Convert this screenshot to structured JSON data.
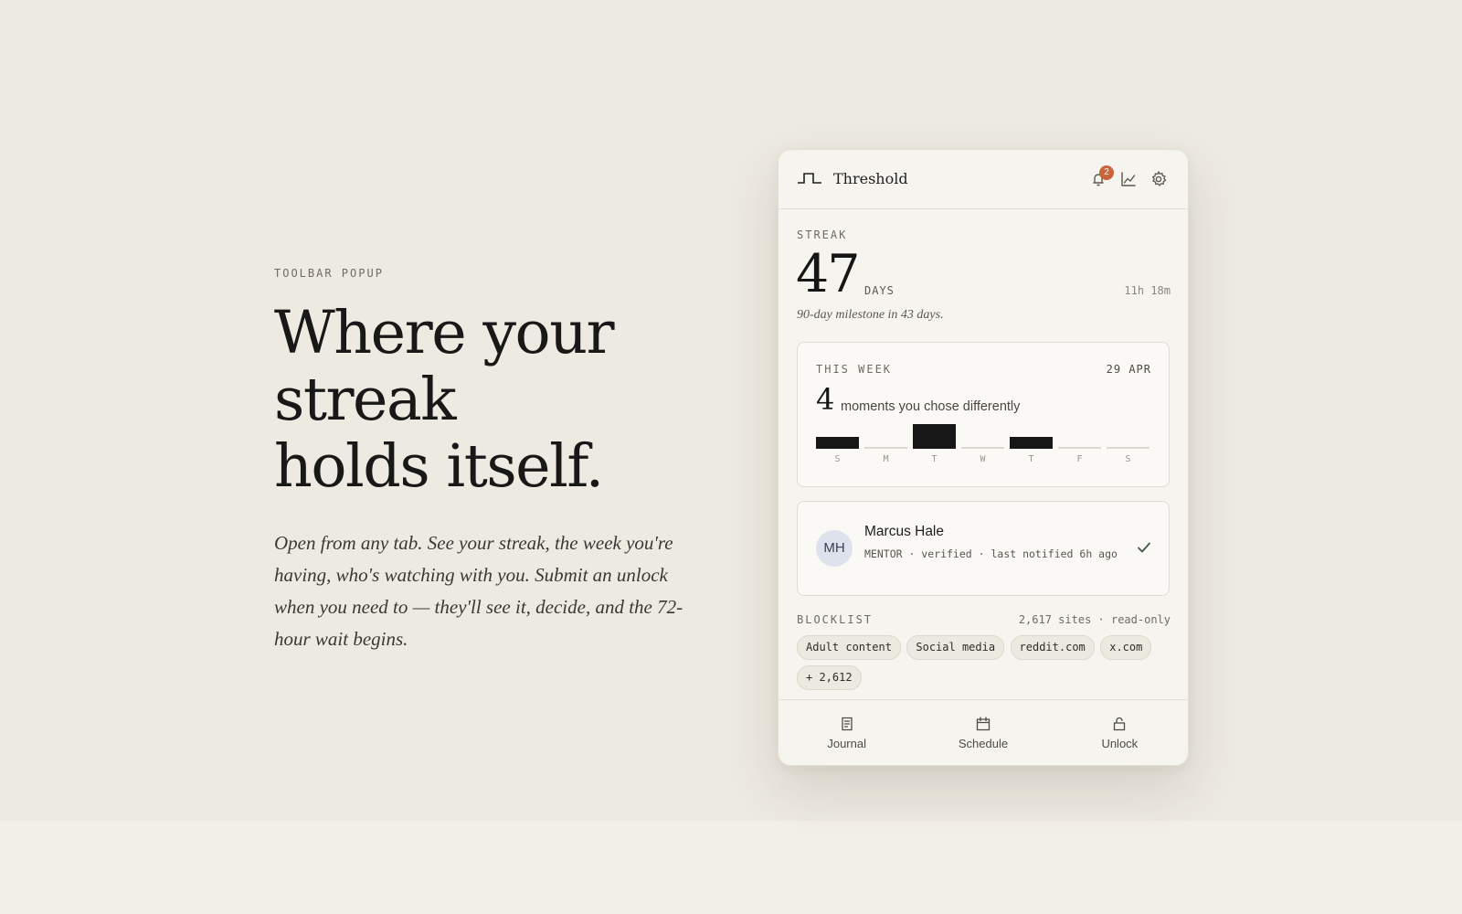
{
  "intro": {
    "eyebrow": "TOOLBAR POPUP",
    "headline_lines": [
      "Where your",
      "streak",
      "holds itself."
    ],
    "lede": "Open from any tab. See your streak, the week you're having, who's watching with you. Submit an unlock when you need to — they'll see it, decide, and the 72-hour wait begins."
  },
  "popup": {
    "brand": "Threshold",
    "header_icons": [
      "bell-icon",
      "chart-icon",
      "gear-icon"
    ],
    "notification_count": "2",
    "streak": {
      "label": "STREAK",
      "days": "47",
      "unit": "DAYS",
      "timer": "11h 18m",
      "milestone": "90-day milestone in 43 days."
    },
    "week": {
      "label": "THIS WEEK",
      "date": "29 APR",
      "count": "4",
      "count_text": "moments you chose differently",
      "days": [
        "S",
        "M",
        "T",
        "W",
        "T",
        "F",
        "S"
      ],
      "moments": [
        1,
        0,
        2,
        0,
        1,
        0,
        0
      ]
    },
    "mentor": {
      "initials": "MH",
      "name": "Marcus Hale",
      "meta": "MENTOR · verified · last notified 6h ago",
      "status_icon": "check-icon"
    },
    "blocklist": {
      "label": "BLOCKLIST",
      "meta": "2,617 sites · read-only",
      "chips": [
        "Adult content",
        "Social media",
        "reddit.com",
        "x.com"
      ],
      "more": "+ 2,612"
    },
    "nav": [
      {
        "label": "Journal",
        "icon": "journal-icon"
      },
      {
        "label": "Schedule",
        "icon": "calendar-icon"
      },
      {
        "label": "Unlock",
        "icon": "unlock-icon"
      }
    ],
    "colors": {
      "accent": "#c9653a",
      "ink": "#171717",
      "avatar_bg": "#dde2ec",
      "check": "#3d5a45"
    }
  }
}
